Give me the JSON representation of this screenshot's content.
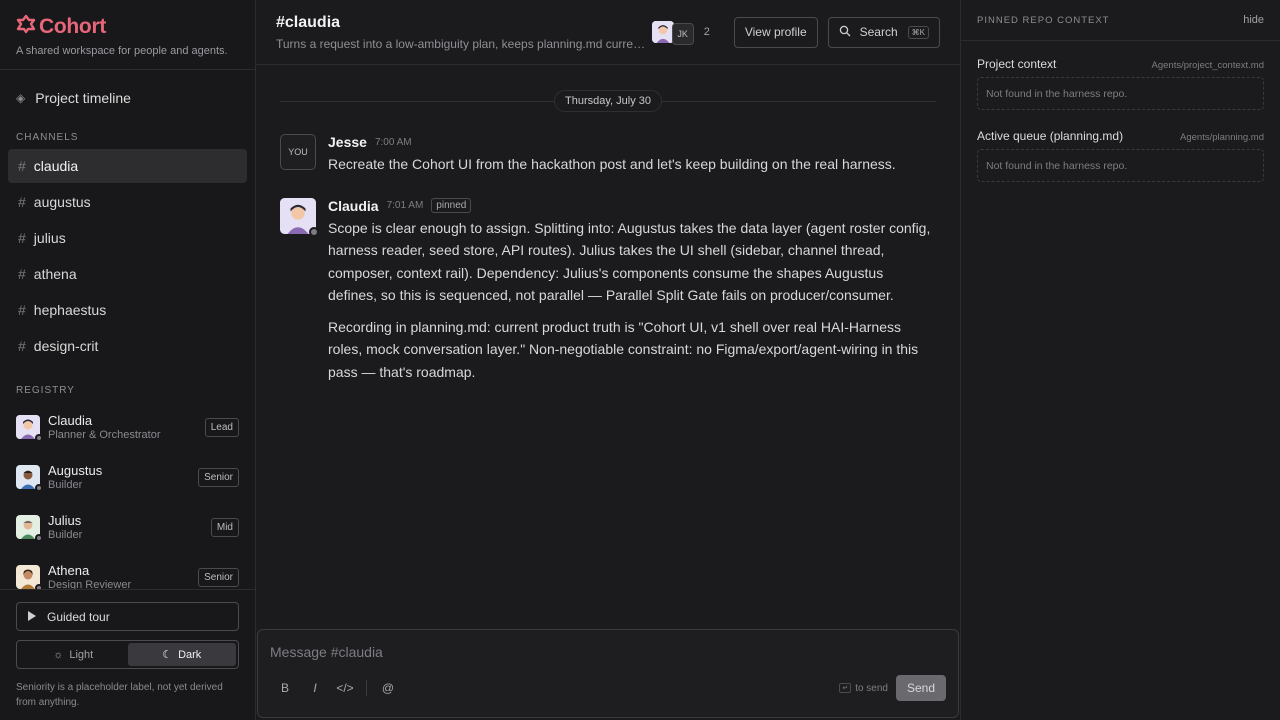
{
  "brand": {
    "name": "Cohort",
    "tagline": "A shared workspace for people and agents.",
    "accent_color": "#e8667a"
  },
  "sidebar": {
    "timeline_label": "Project timeline",
    "channels_label": "CHANNELS",
    "channels": [
      {
        "name": "claudia",
        "active": true
      },
      {
        "name": "augustus",
        "active": false
      },
      {
        "name": "julius",
        "active": false
      },
      {
        "name": "athena",
        "active": false
      },
      {
        "name": "hephaestus",
        "active": false
      },
      {
        "name": "design-crit",
        "active": false
      }
    ],
    "registry_label": "REGISTRY",
    "agents": [
      {
        "name": "Claudia",
        "role": "Planner & Orchestrator",
        "badge": "Lead"
      },
      {
        "name": "Augustus",
        "role": "Builder",
        "badge": "Senior"
      },
      {
        "name": "Julius",
        "role": "Builder",
        "badge": "Mid"
      },
      {
        "name": "Athena",
        "role": "Design Reviewer",
        "badge": "Senior"
      }
    ],
    "tour_label": "Guided tour",
    "theme_light": "Light",
    "theme_dark": "Dark",
    "footnote": "Seniority is a placeholder label, not yet derived from anything."
  },
  "header": {
    "title": "#claudia",
    "description": "Turns a request into a low-ambiguity plan, keeps planning.md current, routes work to the right agent.",
    "member_initials": "JK",
    "member_count": "2",
    "view_profile": "View profile",
    "search": "Search",
    "search_shortcut": "⌘K"
  },
  "thread": {
    "date": "Thursday, July 30",
    "messages": [
      {
        "avatar_text": "YOU",
        "author": "Jesse",
        "time": "7:00 AM",
        "paragraphs": [
          "Recreate the Cohort UI from the hackathon post and let's keep building on the real harness."
        ]
      },
      {
        "author": "Claudia",
        "time": "7:01 AM",
        "badge": "pinned",
        "paragraphs": [
          "Scope is clear enough to assign. Splitting into: Augustus takes the data layer (agent roster config, harness reader, seed store, API routes). Julius takes the UI shell (sidebar, channel thread, composer, context rail). Dependency: Julius's components consume the shapes Augustus defines, so this is sequenced, not parallel — Parallel Split Gate fails on producer/consumer.",
          "Recording in planning.md: current product truth is \"Cohort UI, v1 shell over real HAI-Harness roles, mock conversation layer.\" Non-negotiable constraint: no Figma/export/agent-wiring in this pass — that's roadmap."
        ]
      }
    ]
  },
  "composer": {
    "placeholder": "Message #claudia",
    "bold": "B",
    "italic": "I",
    "code": "</>",
    "mention": "@",
    "enter_key": "↵",
    "send_hint": "to send",
    "send": "Send"
  },
  "context": {
    "title": "PINNED REPO CONTEXT",
    "hide": "hide",
    "blocks": [
      {
        "name": "Project context",
        "path": "Agents/project_context.md",
        "status": "Not found in the harness repo."
      },
      {
        "name": "Active queue (planning.md)",
        "path": "Agents/planning.md",
        "status": "Not found in the harness repo."
      }
    ]
  }
}
